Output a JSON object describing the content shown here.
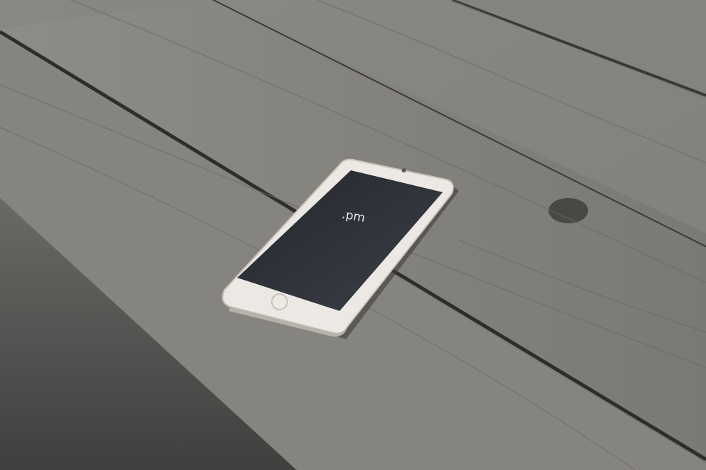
{
  "photo": {
    "subject": "smartphone",
    "screen_text": ".pm"
  },
  "colors": {
    "wood_light": "#8f8d87",
    "wood_mid": "#77756f",
    "wood_dark": "#4f4f4d",
    "seam": "#2c2b29",
    "phone_body": "#ece9e4",
    "phone_screen": "#2a2c31"
  }
}
